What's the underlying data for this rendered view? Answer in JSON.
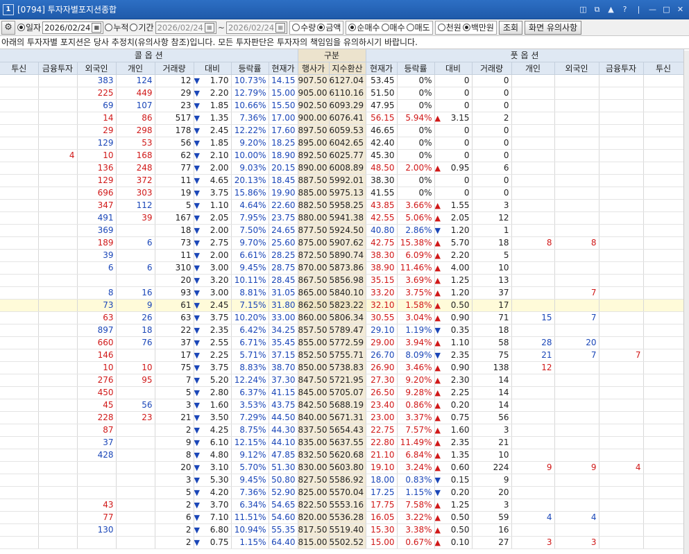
{
  "window": {
    "number": "1",
    "title": "[0794] 투자자별포지션종합"
  },
  "toolbar": {
    "mode_daily": "일자",
    "date": "2026/02/24",
    "mode_cumulative": "누적",
    "mode_period": "기간",
    "period_from": "2026/02/24",
    "period_to": "2026/02/24",
    "tilde": "~",
    "qty": "수량",
    "amount": "금액",
    "net_buy": "순매수",
    "buy": "매수",
    "sell": "매도",
    "won": "천원",
    "million": "백만원",
    "search_btn": "조회",
    "notice_btn": "화면 유의사항"
  },
  "notice": "아래의 투자자별 포지션은 당사 추정치(유의사항 참조)입니다. 모든 투자판단은 투자자의 책임임을 유의하시기 바랍니다.",
  "headers": {
    "call": "콜 옵 션",
    "mid": "구분",
    "put": "풋 옵 션",
    "columns": [
      "투신",
      "금융투자",
      "외국인",
      "개인",
      "거래량",
      "대비",
      "등락률",
      "현재가",
      "행사가",
      "지수환산",
      "현재가",
      "등락률",
      "대비",
      "거래량",
      "개인",
      "외국인",
      "금융투자",
      "투신"
    ]
  },
  "colors": {
    "up": "#d01818",
    "down": "#1a46b8",
    "highlight": "#fffbd9",
    "strike": "#f2ead7"
  },
  "rows": [
    {
      "c": [
        "",
        "",
        "383",
        "124",
        "12",
        "1.70",
        "10.73%",
        "14.15"
      ],
      "cd": "dn",
      "s": "907.50",
      "idx": "6127.04",
      "p": [
        "53.45",
        "0%",
        "0",
        "0",
        "",
        "",
        "",
        ""
      ],
      "pd": ""
    },
    {
      "c": [
        "",
        "",
        "225",
        "449",
        "29",
        "2.20",
        "12.79%",
        "15.00"
      ],
      "cd": "dn",
      "s": "905.00",
      "idx": "6110.16",
      "p": [
        "51.50",
        "0%",
        "0",
        "0",
        "",
        "",
        "",
        ""
      ],
      "pd": ""
    },
    {
      "c": [
        "",
        "",
        "69",
        "107",
        "23",
        "1.85",
        "10.66%",
        "15.50"
      ],
      "cd": "dn",
      "s": "902.50",
      "idx": "6093.29",
      "p": [
        "47.95",
        "0%",
        "0",
        "0",
        "",
        "",
        "",
        ""
      ],
      "pd": ""
    },
    {
      "c": [
        "",
        "",
        "14",
        "86",
        "517",
        "1.35",
        "7.36%",
        "17.00"
      ],
      "cd": "dn",
      "s": "900.00",
      "idx": "6076.41",
      "p": [
        "56.15",
        "5.94%",
        "3.15",
        "2",
        "",
        "",
        "",
        ""
      ],
      "pd": "up"
    },
    {
      "c": [
        "",
        "",
        "29",
        "298",
        "178",
        "2.45",
        "12.22%",
        "17.60"
      ],
      "cd": "dn",
      "s": "897.50",
      "idx": "6059.53",
      "p": [
        "46.65",
        "0%",
        "0",
        "0",
        "",
        "",
        "",
        ""
      ],
      "pd": ""
    },
    {
      "c": [
        "",
        "",
        "129",
        "53",
        "56",
        "1.85",
        "9.20%",
        "18.25"
      ],
      "cd": "dn",
      "s": "895.00",
      "idx": "6042.65",
      "p": [
        "42.40",
        "0%",
        "0",
        "0",
        "",
        "",
        "",
        ""
      ],
      "pd": ""
    },
    {
      "c": [
        "",
        "4",
        "10",
        "168",
        "62",
        "2.10",
        "10.00%",
        "18.90"
      ],
      "cd": "dn",
      "s": "892.50",
      "idx": "6025.77",
      "p": [
        "45.30",
        "0%",
        "0",
        "0",
        "",
        "",
        "",
        ""
      ],
      "pd": ""
    },
    {
      "c": [
        "",
        "",
        "136",
        "248",
        "77",
        "2.00",
        "9.03%",
        "20.15"
      ],
      "cd": "dn",
      "s": "890.00",
      "idx": "6008.89",
      "p": [
        "48.50",
        "2.00%",
        "0.95",
        "6",
        "",
        "",
        "",
        ""
      ],
      "pd": "up"
    },
    {
      "c": [
        "",
        "",
        "129",
        "372",
        "11",
        "4.65",
        "20.13%",
        "18.45"
      ],
      "cd": "dn",
      "s": "887.50",
      "idx": "5992.01",
      "p": [
        "38.30",
        "0%",
        "0",
        "0",
        "",
        "",
        "",
        ""
      ],
      "pd": ""
    },
    {
      "c": [
        "",
        "",
        "696",
        "303",
        "19",
        "3.75",
        "15.86%",
        "19.90"
      ],
      "cd": "dn",
      "s": "885.00",
      "idx": "5975.13",
      "p": [
        "41.55",
        "0%",
        "0",
        "0",
        "",
        "",
        "",
        ""
      ],
      "pd": ""
    },
    {
      "c": [
        "",
        "",
        "347",
        "112",
        "5",
        "1.10",
        "4.64%",
        "22.60"
      ],
      "cd": "dn",
      "s": "882.50",
      "idx": "5958.25",
      "p": [
        "43.85",
        "3.66%",
        "1.55",
        "3",
        "",
        "",
        "",
        ""
      ],
      "pd": "up"
    },
    {
      "c": [
        "",
        "",
        "491",
        "39",
        "167",
        "2.05",
        "7.95%",
        "23.75"
      ],
      "cd": "dn",
      "s": "880.00",
      "idx": "5941.38",
      "p": [
        "42.55",
        "5.06%",
        "2.05",
        "12",
        "",
        "",
        "",
        ""
      ],
      "pd": "up"
    },
    {
      "c": [
        "",
        "",
        "369",
        "",
        "18",
        "2.00",
        "7.50%",
        "24.65"
      ],
      "cd": "dn",
      "s": "877.50",
      "idx": "5924.50",
      "p": [
        "40.80",
        "2.86%",
        "1.20",
        "1",
        "",
        "",
        "",
        ""
      ],
      "pd": "dn"
    },
    {
      "c": [
        "",
        "",
        "189",
        "6",
        "73",
        "2.75",
        "9.70%",
        "25.60"
      ],
      "cd": "dn",
      "s": "875.00",
      "idx": "5907.62",
      "p": [
        "42.75",
        "15.38%",
        "5.70",
        "18",
        "8",
        "8",
        "",
        ""
      ],
      "pd": "up"
    },
    {
      "c": [
        "",
        "",
        "39",
        "",
        "11",
        "2.00",
        "6.61%",
        "28.25"
      ],
      "cd": "dn",
      "s": "872.50",
      "idx": "5890.74",
      "p": [
        "38.30",
        "6.09%",
        "2.20",
        "5",
        "",
        "",
        "",
        ""
      ],
      "pd": "up"
    },
    {
      "c": [
        "",
        "",
        "6",
        "6",
        "310",
        "3.00",
        "9.45%",
        "28.75"
      ],
      "cd": "dn",
      "s": "870.00",
      "idx": "5873.86",
      "p": [
        "38.90",
        "11.46%",
        "4.00",
        "10",
        "",
        "",
        "",
        ""
      ],
      "pd": "up"
    },
    {
      "c": [
        "",
        "",
        "",
        "",
        "20",
        "3.20",
        "10.11%",
        "28.45"
      ],
      "cd": "dn",
      "s": "867.50",
      "idx": "5856.98",
      "p": [
        "35.15",
        "3.69%",
        "1.25",
        "13",
        "",
        "",
        "",
        ""
      ],
      "pd": "up"
    },
    {
      "c": [
        "",
        "",
        "8",
        "16",
        "93",
        "3.00",
        "8.81%",
        "31.05"
      ],
      "cd": "dn",
      "s": "865.00",
      "idx": "5840.10",
      "p": [
        "33.20",
        "3.75%",
        "1.20",
        "37",
        "",
        "7",
        "",
        ""
      ],
      "pd": "up"
    },
    {
      "c": [
        "",
        "",
        "73",
        "9",
        "61",
        "2.45",
        "7.15%",
        "31.80"
      ],
      "cd": "dn",
      "s": "862.50",
      "idx": "5823.22",
      "p": [
        "32.10",
        "1.58%",
        "0.50",
        "17",
        "",
        "",
        "",
        ""
      ],
      "pd": "up",
      "hl": true
    },
    {
      "c": [
        "",
        "",
        "63",
        "26",
        "63",
        "3.75",
        "10.20%",
        "33.00"
      ],
      "cd": "dn",
      "s": "860.00",
      "idx": "5806.34",
      "p": [
        "30.55",
        "3.04%",
        "0.90",
        "71",
        "15",
        "7",
        "",
        ""
      ],
      "pd": "up"
    },
    {
      "c": [
        "",
        "",
        "897",
        "18",
        "22",
        "2.35",
        "6.42%",
        "34.25"
      ],
      "cd": "dn",
      "s": "857.50",
      "idx": "5789.47",
      "p": [
        "29.10",
        "1.19%",
        "0.35",
        "18",
        "",
        "",
        "",
        ""
      ],
      "pd": "dn"
    },
    {
      "c": [
        "",
        "",
        "660",
        "76",
        "37",
        "2.55",
        "6.71%",
        "35.45"
      ],
      "cd": "dn",
      "s": "855.00",
      "idx": "5772.59",
      "p": [
        "29.00",
        "3.94%",
        "1.10",
        "58",
        "28",
        "20",
        "",
        ""
      ],
      "pd": "up"
    },
    {
      "c": [
        "",
        "",
        "146",
        "",
        "17",
        "2.25",
        "5.71%",
        "37.15"
      ],
      "cd": "dn",
      "s": "852.50",
      "idx": "5755.71",
      "p": [
        "26.70",
        "8.09%",
        "2.35",
        "75",
        "21",
        "7",
        "7",
        ""
      ],
      "pd": "dn"
    },
    {
      "c": [
        "",
        "",
        "10",
        "10",
        "75",
        "3.75",
        "8.83%",
        "38.70"
      ],
      "cd": "dn",
      "s": "850.00",
      "idx": "5738.83",
      "p": [
        "26.90",
        "3.46%",
        "0.90",
        "138",
        "12",
        "",
        "",
        ""
      ],
      "pd": "up"
    },
    {
      "c": [
        "",
        "",
        "276",
        "95",
        "7",
        "5.20",
        "12.24%",
        "37.30"
      ],
      "cd": "dn",
      "s": "847.50",
      "idx": "5721.95",
      "p": [
        "27.30",
        "9.20%",
        "2.30",
        "14",
        "",
        "",
        "",
        ""
      ],
      "pd": "up"
    },
    {
      "c": [
        "",
        "",
        "450",
        "",
        "5",
        "2.80",
        "6.37%",
        "41.15"
      ],
      "cd": "dn",
      "s": "845.00",
      "idx": "5705.07",
      "p": [
        "26.50",
        "9.28%",
        "2.25",
        "14",
        "",
        "",
        "",
        ""
      ],
      "pd": "up"
    },
    {
      "c": [
        "",
        "",
        "45",
        "56",
        "3",
        "1.60",
        "3.53%",
        "43.75"
      ],
      "cd": "dn",
      "s": "842.50",
      "idx": "5688.19",
      "p": [
        "23.40",
        "0.86%",
        "0.20",
        "14",
        "",
        "",
        "",
        ""
      ],
      "pd": "up"
    },
    {
      "c": [
        "",
        "",
        "228",
        "23",
        "21",
        "3.50",
        "7.29%",
        "44.50"
      ],
      "cd": "dn",
      "s": "840.00",
      "idx": "5671.31",
      "p": [
        "23.00",
        "3.37%",
        "0.75",
        "56",
        "",
        "",
        "",
        ""
      ],
      "pd": "up"
    },
    {
      "c": [
        "",
        "",
        "87",
        "",
        "2",
        "4.25",
        "8.75%",
        "44.30"
      ],
      "cd": "dn",
      "s": "837.50",
      "idx": "5654.43",
      "p": [
        "22.75",
        "7.57%",
        "1.60",
        "3",
        "",
        "",
        "",
        ""
      ],
      "pd": "up"
    },
    {
      "c": [
        "",
        "",
        "37",
        "",
        "9",
        "6.10",
        "12.15%",
        "44.10"
      ],
      "cd": "dn",
      "s": "835.00",
      "idx": "5637.55",
      "p": [
        "22.80",
        "11.49%",
        "2.35",
        "21",
        "",
        "",
        "",
        ""
      ],
      "pd": "up"
    },
    {
      "c": [
        "",
        "",
        "428",
        "",
        "8",
        "4.80",
        "9.12%",
        "47.85"
      ],
      "cd": "dn",
      "s": "832.50",
      "idx": "5620.68",
      "p": [
        "21.10",
        "6.84%",
        "1.35",
        "10",
        "",
        "",
        "",
        ""
      ],
      "pd": "up"
    },
    {
      "c": [
        "",
        "",
        "",
        "",
        "20",
        "3.10",
        "5.70%",
        "51.30"
      ],
      "cd": "dn",
      "s": "830.00",
      "idx": "5603.80",
      "p": [
        "19.10",
        "3.24%",
        "0.60",
        "224",
        "9",
        "9",
        "4",
        ""
      ],
      "pd": "up"
    },
    {
      "c": [
        "",
        "",
        "",
        "",
        "3",
        "5.30",
        "9.45%",
        "50.80"
      ],
      "cd": "dn",
      "s": "827.50",
      "idx": "5586.92",
      "p": [
        "18.00",
        "0.83%",
        "0.15",
        "9",
        "",
        "",
        "",
        ""
      ],
      "pd": "dn"
    },
    {
      "c": [
        "",
        "",
        "",
        "",
        "5",
        "4.20",
        "7.36%",
        "52.90"
      ],
      "cd": "dn",
      "s": "825.00",
      "idx": "5570.04",
      "p": [
        "17.25",
        "1.15%",
        "0.20",
        "20",
        "",
        "",
        "",
        ""
      ],
      "pd": "dn"
    },
    {
      "c": [
        "",
        "",
        "43",
        "",
        "2",
        "3.70",
        "6.34%",
        "54.65"
      ],
      "cd": "dn",
      "s": "822.50",
      "idx": "5553.16",
      "p": [
        "17.75",
        "7.58%",
        "1.25",
        "3",
        "",
        "",
        "",
        ""
      ],
      "pd": "up"
    },
    {
      "c": [
        "",
        "",
        "77",
        "",
        "6",
        "7.10",
        "11.51%",
        "54.60"
      ],
      "cd": "dn",
      "s": "820.00",
      "idx": "5536.28",
      "p": [
        "16.05",
        "3.22%",
        "0.50",
        "59",
        "4",
        "4",
        "",
        ""
      ],
      "pd": "up"
    },
    {
      "c": [
        "",
        "",
        "130",
        "",
        "2",
        "6.80",
        "10.94%",
        "55.35"
      ],
      "cd": "dn",
      "s": "817.50",
      "idx": "5519.40",
      "p": [
        "15.30",
        "3.38%",
        "0.50",
        "16",
        "",
        "",
        "",
        ""
      ],
      "pd": "up"
    },
    {
      "c": [
        "",
        "",
        "",
        "",
        "2",
        "0.75",
        "1.15%",
        "64.40"
      ],
      "cd": "dn",
      "s": "815.00",
      "idx": "5502.52",
      "p": [
        "15.00",
        "0.67%",
        "0.10",
        "27",
        "3",
        "3",
        "",
        ""
      ],
      "pd": "up"
    }
  ]
}
